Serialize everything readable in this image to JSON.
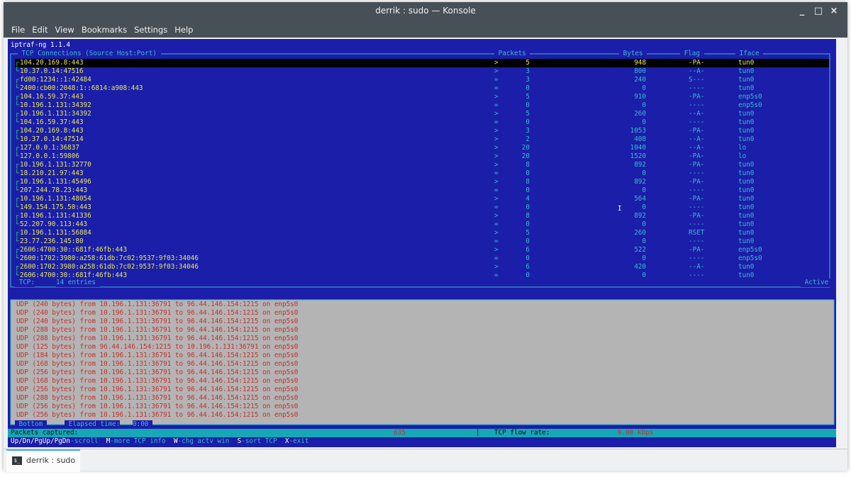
{
  "window": {
    "title": "derrik : sudo — Konsole",
    "minimize": "_",
    "maximize": "□",
    "close": "×"
  },
  "menu": [
    "File",
    "Edit",
    "View",
    "Bookmarks",
    "Settings",
    "Help"
  ],
  "app_title": "iptraf-ng 1.1.4",
  "headers": {
    "connections": " TCP Connections (Source Host:Port) ",
    "packets": " Packets ",
    "bytes": " Bytes ",
    "flag": " Flag ",
    "iface": " Iface "
  },
  "tcp_rows": [
    {
      "host": "104.20.169.8:443",
      "dir": ">",
      "packets": "5",
      "bytes": "948",
      "flag": "-PA-",
      "iface": "tun0"
    },
    {
      "host": "10.37.0.14:47516",
      "dir": ">",
      "packets": "3",
      "bytes": "800",
      "flag": "--A-",
      "iface": "tun0"
    },
    {
      "host": "fd00:1234::1:42484",
      "dir": "=",
      "packets": "3",
      "bytes": "240",
      "flag": "S---",
      "iface": "tun0"
    },
    {
      "host": "2400:cb00:2048:1::6814:a908:443",
      "dir": "=",
      "packets": "0",
      "bytes": "0",
      "flag": "----",
      "iface": "tun0"
    },
    {
      "host": "104.16.59.37:443",
      "dir": ">",
      "packets": "5",
      "bytes": "910",
      "flag": "-PA-",
      "iface": "enp5s0"
    },
    {
      "host": "10.196.1.131:34392",
      "dir": "=",
      "packets": "0",
      "bytes": "0",
      "flag": "----",
      "iface": "enp5s0"
    },
    {
      "host": "10.196.1.131:34392",
      "dir": ">",
      "packets": "5",
      "bytes": "260",
      "flag": "--A-",
      "iface": "tun0"
    },
    {
      "host": "104.16.59.37:443",
      "dir": "=",
      "packets": "0",
      "bytes": "0",
      "flag": "----",
      "iface": "tun0"
    },
    {
      "host": "104.20.169.8:443",
      "dir": ">",
      "packets": "3",
      "bytes": "1053",
      "flag": "-PA-",
      "iface": "tun0"
    },
    {
      "host": "10.37.0.14:47514",
      "dir": ">",
      "packets": "2",
      "bytes": "408",
      "flag": "--A-",
      "iface": "tun0"
    },
    {
      "host": "127.0.0.1:36837",
      "dir": ">",
      "packets": "20",
      "bytes": "1040",
      "flag": "--A-",
      "iface": "lo"
    },
    {
      "host": "127.0.0.1:59806",
      "dir": ">",
      "packets": "20",
      "bytes": "1520",
      "flag": "-PA-",
      "iface": "lo"
    },
    {
      "host": "10.196.1.131:32770",
      "dir": ">",
      "packets": "8",
      "bytes": "892",
      "flag": "-PA-",
      "iface": "tun0"
    },
    {
      "host": "18.210.21.97:443",
      "dir": "=",
      "packets": "0",
      "bytes": "0",
      "flag": "----",
      "iface": "tun0"
    },
    {
      "host": "10.196.1.131:45496",
      "dir": ">",
      "packets": "8",
      "bytes": "892",
      "flag": "-PA-",
      "iface": "tun0"
    },
    {
      "host": "207.244.78.23:443",
      "dir": "=",
      "packets": "0",
      "bytes": "0",
      "flag": "----",
      "iface": "tun0"
    },
    {
      "host": "10.196.1.131:48054",
      "dir": ">",
      "packets": "4",
      "bytes": "564",
      "flag": "-PA-",
      "iface": "tun0"
    },
    {
      "host": "149.154.175.50:443",
      "dir": "=",
      "packets": "0",
      "bytes": "0",
      "flag": "----",
      "iface": "tun0"
    },
    {
      "host": "10.196.1.131:41336",
      "dir": ">",
      "packets": "8",
      "bytes": "892",
      "flag": "-PA-",
      "iface": "tun0"
    },
    {
      "host": "52.207.90.113:443",
      "dir": "=",
      "packets": "0",
      "bytes": "0",
      "flag": "----",
      "iface": "tun0"
    },
    {
      "host": "10.196.1.131:56884",
      "dir": ">",
      "packets": "5",
      "bytes": "260",
      "flag": "RSET",
      "iface": "tun0"
    },
    {
      "host": "23.77.236.145:80",
      "dir": "=",
      "packets": "0",
      "bytes": "0",
      "flag": "----",
      "iface": "tun0"
    },
    {
      "host": "2606:4700:30::681f:46fb:443",
      "dir": ">",
      "packets": "6",
      "bytes": "522",
      "flag": "-PA-",
      "iface": "enp5s0"
    },
    {
      "host": "2600:1702:3980:a258:61db:7c02:9537:9f03:34046",
      "dir": "=",
      "packets": "0",
      "bytes": "0",
      "flag": "----",
      "iface": "enp5s0"
    },
    {
      "host": "2600:1702:3980:a258:61db:7c02:9537:9f03:34046",
      "dir": ">",
      "packets": "6",
      "bytes": "420",
      "flag": "--A-",
      "iface": "tun0"
    },
    {
      "host": "2606:4700:30::681f:46fb:443",
      "dir": "=",
      "packets": "0",
      "bytes": "0",
      "flag": "----",
      "iface": "tun0"
    }
  ],
  "tcp_footer": {
    "label": " TCP:",
    "entries": "14 entries ",
    "active": " Active "
  },
  "udp_lines": [
    "UDP (240 bytes) from 10.196.1.131:36791 to 96.44.146.154:1215 on enp5s0",
    "UDP (240 bytes) from 10.196.1.131:36791 to 96.44.146.154:1215 on enp5s0",
    "UDP (240 bytes) from 10.196.1.131:36791 to 96.44.146.154:1215 on enp5s0",
    "UDP (288 bytes) from 10.196.1.131:36791 to 96.44.146.154:1215 on enp5s0",
    "UDP (288 bytes) from 10.196.1.131:36791 to 96.44.146.154:1215 on enp5s0",
    "UDP (125 bytes) from 96.44.146.154:1215 to 10.196.1.131:36791 on enp5s0",
    "UDP (184 bytes) from 10.196.1.131:36791 to 96.44.146.154:1215 on enp5s0",
    "UDP (168 bytes) from 10.196.1.131:36791 to 96.44.146.154:1215 on enp5s0",
    "UDP (256 bytes) from 10.196.1.131:36791 to 96.44.146.154:1215 on enp5s0",
    "UDP (168 bytes) from 10.196.1.131:36791 to 96.44.146.154:1215 on enp5s0",
    "UDP (256 bytes) from 10.196.1.131:36791 to 96.44.146.154:1215 on enp5s0",
    "UDP (288 bytes) from 10.196.1.131:36791 to 96.44.146.154:1215 on enp5s0",
    "UDP (256 bytes) from 10.196.1.131:36791 to 96.44.146.154:1215 on enp5s0",
    "UDP (256 bytes) from 10.196.1.131:36791 to 96.44.146.154:1215 on enp5s0"
  ],
  "bottom": {
    "label": " Bottom ",
    "elapsed_label": " Elapsed time:",
    "elapsed_value": "0:00 "
  },
  "status": {
    "packets_label": "Packets captured:",
    "packets_value": "635",
    "flow_label": "TCP flow rate:",
    "flow_value": "0.00 kbps"
  },
  "keys": [
    {
      "key": "Up/Dn/PgUp/PgDn",
      "desc": "-scroll"
    },
    {
      "key": "M",
      "desc": "-more TCP info"
    },
    {
      "key": "W",
      "desc": "-chg actv win"
    },
    {
      "key": "S",
      "desc": "-sort TCP"
    },
    {
      "key": "X",
      "desc": "-exit"
    }
  ],
  "tab": {
    "icon": "terminal-icon",
    "label": "derrik : sudo"
  },
  "colors": {
    "term_bg": "#1a1ea8",
    "cyan": "#3fb8d6",
    "yellow": "#e8e85a",
    "green": "#3ee85a",
    "udp_bg": "#b4b4b4",
    "udp_text": "#c23030",
    "status_bg": "#17a7b5",
    "titlebar": "#475057",
    "accent": "#3daee9"
  }
}
